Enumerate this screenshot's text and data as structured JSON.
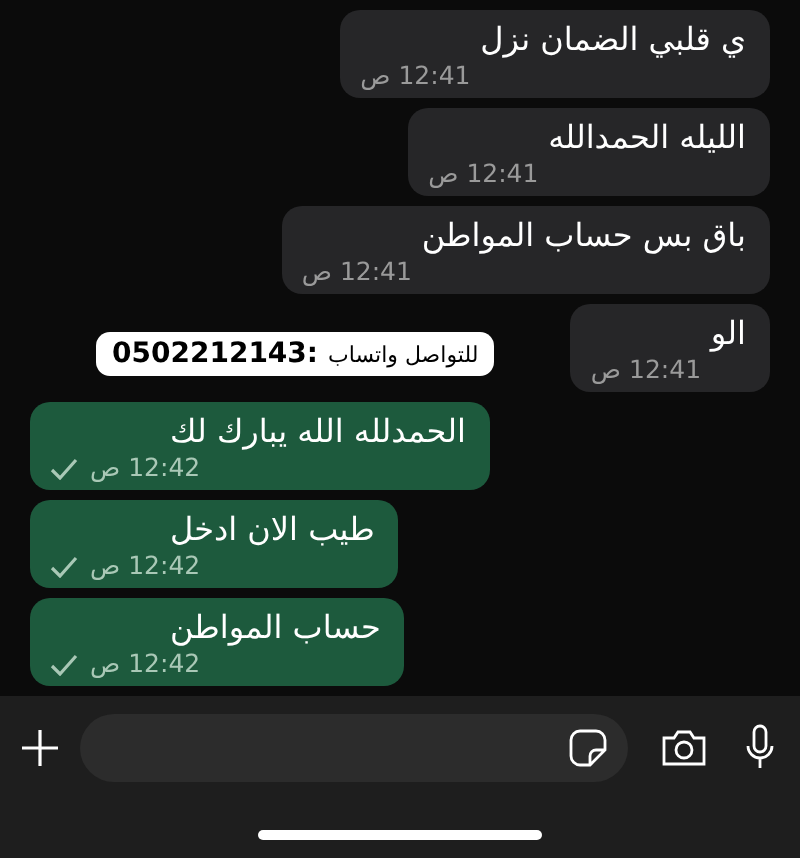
{
  "messages": [
    {
      "kind": "incoming",
      "text": "ي قلبي الضمان نزل",
      "time": "12:41 ص"
    },
    {
      "kind": "incoming",
      "text": "الليله الحمدالله",
      "time": "12:41 ص"
    },
    {
      "kind": "incoming",
      "text": "باق بس حساب المواطن",
      "time": "12:41 ص"
    },
    {
      "kind": "incoming",
      "text": "الو",
      "time": "12:41 ص"
    },
    {
      "kind": "outgoing",
      "text": "الحمدلله الله يبارك لك",
      "time": "12:42 ص"
    },
    {
      "kind": "outgoing",
      "text": "طيب الان ادخل",
      "time": "12:42 ص"
    },
    {
      "kind": "outgoing",
      "text": "حساب المواطن",
      "time": "12:42 ص"
    }
  ],
  "contact_label": {
    "text": "للتواصل واتساب",
    "number": "0502212143:"
  }
}
